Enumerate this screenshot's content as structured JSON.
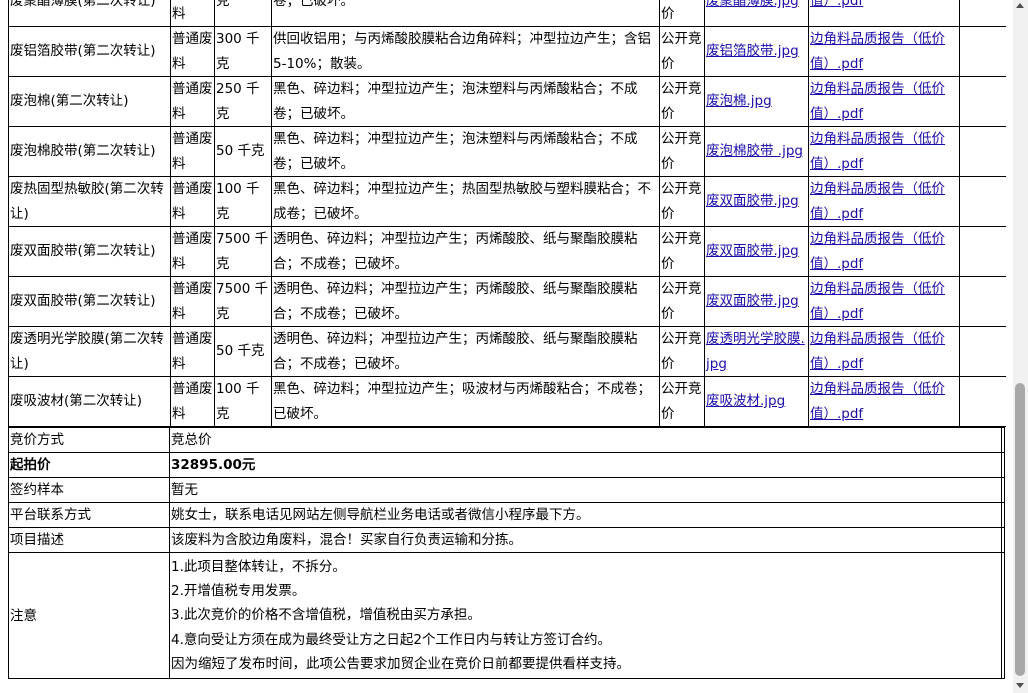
{
  "items": [
    {
      "name": "废聚酯薄膜(第二次转让)",
      "category": "普通废料",
      "quantity": "克",
      "description": "卷；已破坏。",
      "method": "公开竞价",
      "photo": "废聚酯薄膜.jpg",
      "report": "值）.pdf"
    },
    {
      "name": "废铝箔胶带(第二次转让)",
      "category": "普通废料",
      "quantity": "300 千克",
      "description": "供回收铝用；与丙烯酸胶膜粘合边角碎料；冲型拉边产生；含铝5-10%；散装。",
      "method": "公开竞价",
      "photo": "废铝箔胶带.jpg",
      "report": "边角料品质报告（低价值）.pdf"
    },
    {
      "name": "废泡棉(第二次转让)",
      "category": "普通废料",
      "quantity": "250 千克",
      "description": "黑色、碎边料；冲型拉边产生；泡沫塑料与丙烯酸粘合；不成卷；已破坏。",
      "method": "公开竞价",
      "photo": "废泡棉.jpg",
      "report": "边角料品质报告（低价值）.pdf"
    },
    {
      "name": "废泡棉胶带(第二次转让)",
      "category": "普通废料",
      "quantity": "50 千克",
      "description": "黑色、碎边料；冲型拉边产生；泡沫塑料与丙烯酸粘合；不成卷；已破坏。",
      "method": "公开竞价",
      "photo": "废泡棉胶带 .jpg",
      "report": "边角料品质报告（低价值）.pdf"
    },
    {
      "name": "废热固型热敏胶(第二次转让)",
      "category": "普通废料",
      "quantity": "100 千克",
      "description": "黑色、碎边料；冲型拉边产生；热固型热敏胶与塑料膜粘合；不成卷；已破坏。",
      "method": "公开竞价",
      "photo": "废双面胶带.jpg",
      "report": "边角料品质报告（低价值）.pdf"
    },
    {
      "name": "废双面胶带(第二次转让)",
      "category": "普通废料",
      "quantity": "7500 千克",
      "description": "透明色、碎边料；冲型拉边产生；丙烯酸胶、纸与聚酯胶膜粘合；不成卷；已破坏。",
      "method": "公开竞价",
      "photo": "废双面胶带.jpg",
      "report": "边角料品质报告（低价值）.pdf"
    },
    {
      "name": "废双面胶带(第二次转让)",
      "category": "普通废料",
      "quantity": "7500 千克",
      "description": "透明色、碎边料；冲型拉边产生；丙烯酸胶、纸与聚酯胶膜粘合；不成卷；已破坏。",
      "method": "公开竞价",
      "photo": "废双面胶带.jpg",
      "report": "边角料品质报告（低价值）.pdf"
    },
    {
      "name": "废透明光学胶膜(第二次转让)",
      "category": "普通废料",
      "quantity": "50 千克",
      "description": "透明色、碎边料；冲型拉边产生；丙烯酸胶、纸与聚酯胶膜粘合；不成卷；已破坏。",
      "method": "公开竞价",
      "photo": "废透明光学胶膜.jpg",
      "report": "边角料品质报告（低价值）.pdf"
    },
    {
      "name": "废吸波材(第二次转让)",
      "category": "普通废料",
      "quantity": "100 千克",
      "description": "黑色、碎边料；冲型拉边产生；吸波材与丙烯酸粘合；不成卷；已破坏。",
      "method": "公开竞价",
      "photo": "废吸波材.jpg",
      "report": "边角料品质报告（低价值）.pdf"
    }
  ],
  "info": {
    "bid_method_label": "竞价方式",
    "bid_method_value": "竞总价",
    "start_price_label": "起拍价",
    "start_price_value": "32895.00元",
    "sample_label": "签约样本",
    "sample_value": "暂无",
    "contact_label": "平台联系方式",
    "contact_value": "姚女士，联系电话见网站左侧导航栏业务电话或者微信小程序最下方。",
    "description_label": "项目描述",
    "description_value": "该废料为含胶边角废料，混合！买家自行负责运输和分拣。",
    "notes_label": "注意",
    "notes": [
      "1.此项目整体转让，不拆分。",
      "2.开增值税专用发票。",
      "3.此次竞价的价格不含增值税，增值税由买方承担。",
      "4.意向受让方须在成为最终受让方之日起2个工作日内与转让方签订合约。",
      "因为缩短了发布时间，此项公告要求加贸企业在竞价日前都要提供看样支持。"
    ]
  },
  "colors": {
    "link": "#1a0dab",
    "scrollbar_track": "#f1f1f1",
    "scrollbar_thumb": "#a8a8a8"
  }
}
